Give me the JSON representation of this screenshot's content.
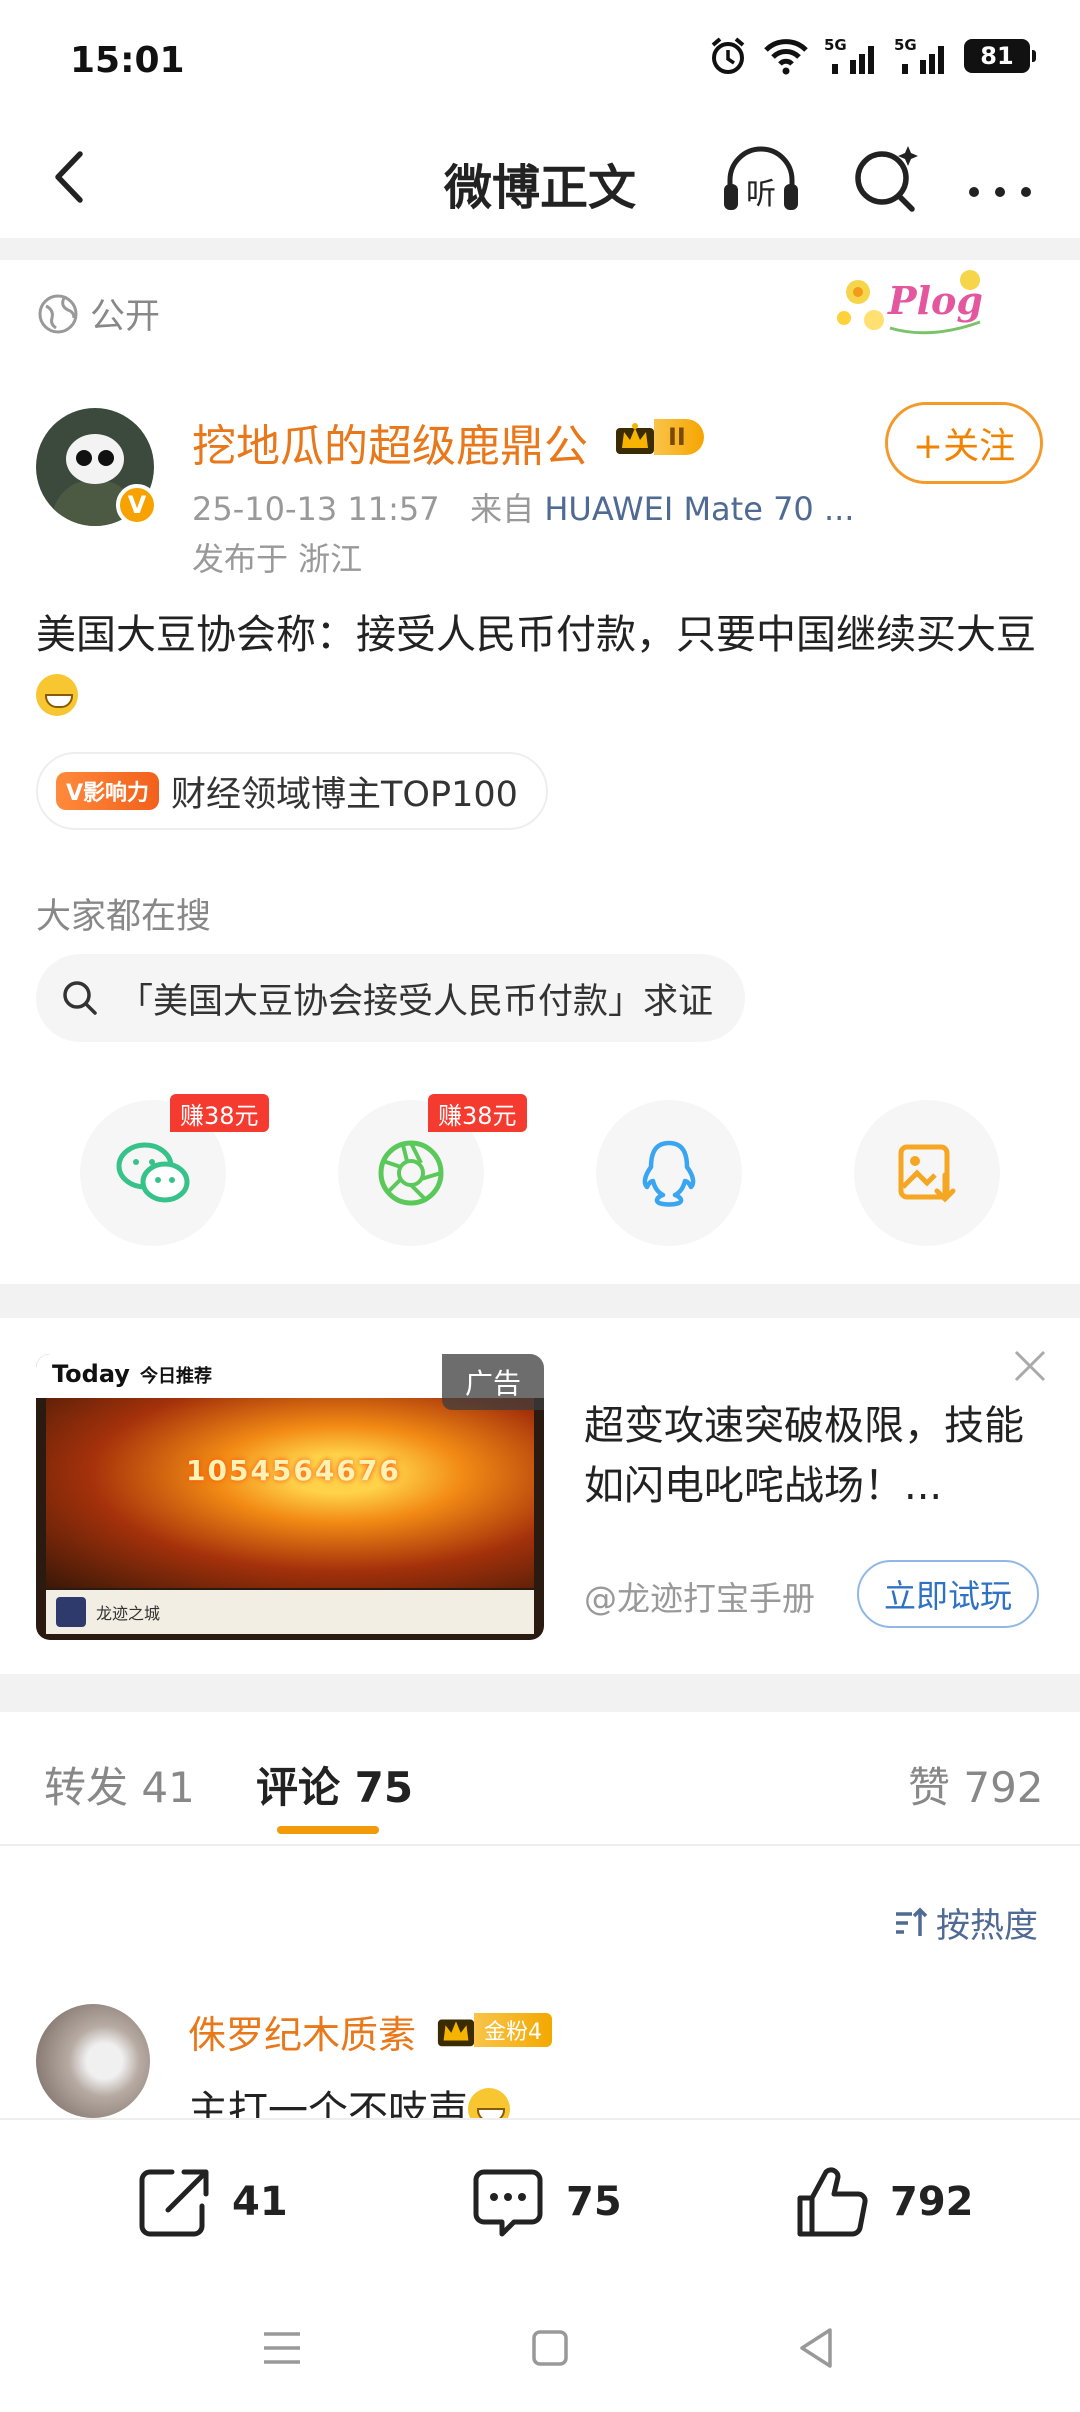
{
  "status_bar": {
    "time": "15:01",
    "battery": "81",
    "net1": "5G",
    "net2": "5G"
  },
  "nav": {
    "title": "微博正文",
    "listen_label": "听"
  },
  "post": {
    "visibility": "公开",
    "username": "挖地瓜的超级鹿鼎公",
    "level": "II",
    "follow_label": "+关注",
    "timestamp": "25-10-13 11:57",
    "source_prefix": "来自",
    "device": "HUAWEI Mate 70 ...",
    "location": "发布于 浙江",
    "text": "美国大豆协会称：接受人民币付款，只要中国继续买大豆",
    "influence_badge": "V影响力",
    "influence_text": "财经领域博主TOP100"
  },
  "hot_search": {
    "title": "大家都在搜",
    "query": "「美国大豆协会接受人民币付款」求证"
  },
  "share": {
    "items": [
      {
        "icon": "wechat-icon",
        "earn": "赚38元"
      },
      {
        "icon": "moments-icon",
        "earn": "赚38元"
      },
      {
        "icon": "qq-icon",
        "earn": ""
      },
      {
        "icon": "save-image-icon",
        "earn": ""
      }
    ]
  },
  "ad": {
    "today": "Today",
    "today_sub": "今日推荐",
    "label": "广告",
    "number": "1054564676",
    "game_name": "龙迹之城",
    "headline": "超变攻速突破极限，技能如闪电叱咤战场！...",
    "source": "@龙迹打宝手册",
    "cta": "立即试玩"
  },
  "tabs": {
    "repost": "转发 41",
    "comments": "评论 75",
    "likes": "赞 792"
  },
  "sort": {
    "label": "按热度"
  },
  "comment": {
    "user": "侏罗纪木质素",
    "fan_badge": "金粉4",
    "text": "主打一个不吱声"
  },
  "actions": {
    "repost_count": "41",
    "comment_count": "75",
    "like_count": "792"
  },
  "colors": {
    "accent": "#f39a0b",
    "username": "#e8781a",
    "link": "#4f6a93"
  }
}
